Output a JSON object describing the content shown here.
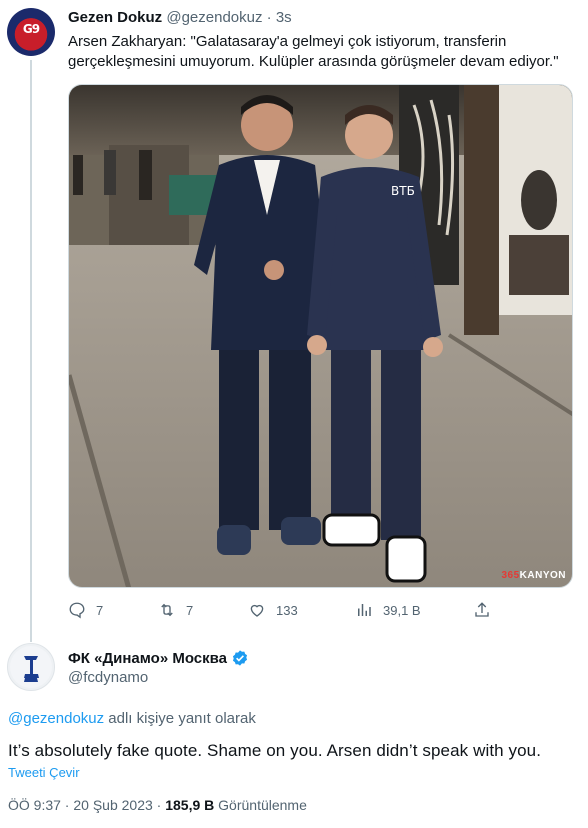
{
  "parent_tweet": {
    "display_name": "Gezen Dokuz",
    "handle": "@gezendokuz",
    "separator": "·",
    "time": "3s",
    "avatar_text": "G9",
    "text": "Arsen Zakharyan: \"Galatasaray'a gelmeyi çok istiyorum, transferin gerçekleşmesini umuyorum. Kulüpler arasında görüşmeler devam ediyor.\"",
    "photo_watermark_prefix": "365",
    "photo_watermark": "KANYON",
    "actions": {
      "reply": {
        "icon": "reply-icon",
        "count": "7"
      },
      "retweet": {
        "icon": "retweet-icon",
        "count": "7"
      },
      "like": {
        "icon": "heart-icon",
        "count": "133"
      },
      "views": {
        "icon": "views-icon",
        "count": "39,1 B"
      },
      "share": {
        "icon": "share-icon"
      }
    }
  },
  "reply_tweet": {
    "display_name": "ФК «Динамо» Москва",
    "verified": true,
    "handle": "@fcdynamo",
    "reply_prefix_mention": "@gezendokuz",
    "reply_suffix": " adlı kişiye yanıt olarak",
    "text": "It’s absolutely fake quote. Shame on you. Arsen didn’t speak with you.",
    "translate_label": "Tweeti Çevir",
    "timestamp": "ÖÖ 9:37 · 20 Şub 2023 · ",
    "views": "185,9 B",
    "views_label": " Görüntülenme"
  },
  "colors": {
    "accent": "#1d9bf0",
    "text": "#0f1419",
    "muted": "#536471",
    "border": "#cfd9de"
  }
}
